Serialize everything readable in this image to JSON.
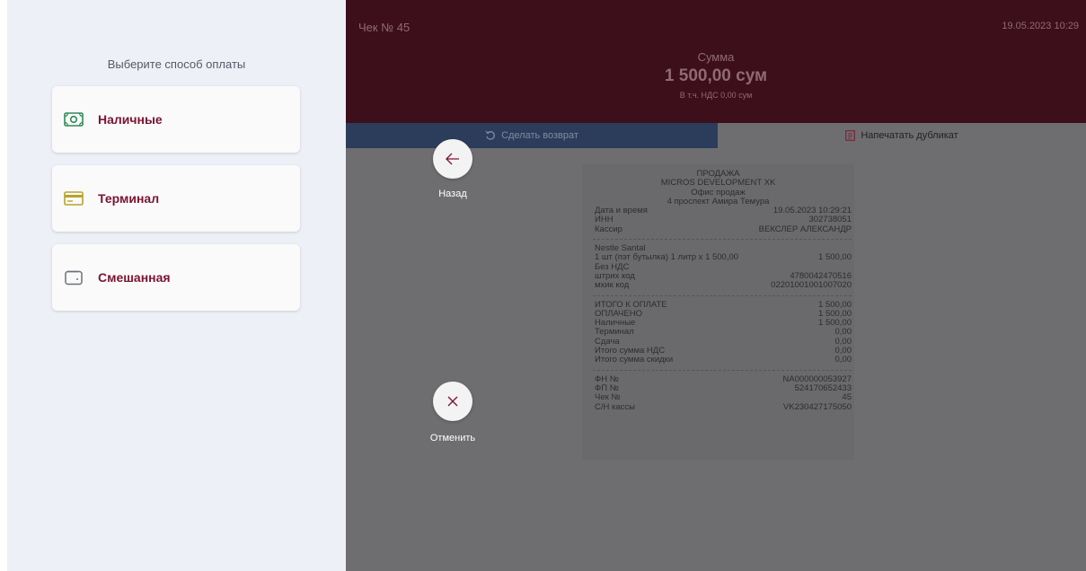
{
  "left_panel": {
    "title": "Выберите способ оплаты",
    "options": [
      {
        "label": "Наличные",
        "icon": "cash-icon"
      },
      {
        "label": "Терминал",
        "icon": "card-terminal-icon"
      },
      {
        "label": "Смешанная",
        "icon": "wallet-icon"
      }
    ]
  },
  "header": {
    "check_no": "Чек № 45",
    "datetime": "19.05.2023 10:29",
    "sum_label": "Сумма",
    "sum_value": "1 500,00 сум",
    "vat": "В т.ч. НДС 0,00 сум"
  },
  "tabs": {
    "refund": "Сделать возврат",
    "duplicate": "Напечатать дубликат"
  },
  "buttons": {
    "back": "Назад",
    "cancel": "Отменить"
  },
  "receipt": {
    "type": "ПРОДАЖА",
    "company": "MICROS DEVELOPMENT XK",
    "office": "Офис продаж",
    "address": "4 проспект Амира Темура",
    "info": [
      {
        "label": "Дата и время",
        "value": "19.05.2023 10:29:21"
      },
      {
        "label": "ИНН",
        "value": "302738051"
      },
      {
        "label": "Кассир",
        "value": "ВЕКСЛЕР АЛЕКСАНДР"
      }
    ],
    "item_name": "Nestle Santal",
    "item_line": "1 шт (пэт бутылка) 1 литр x 1 500,00",
    "item_total": "1 500,00",
    "item_vat": "Без НДС",
    "item_codes": [
      {
        "label": "штрих код",
        "value": "4780042470516"
      },
      {
        "label": "мхик код",
        "value": "02201001001007020"
      }
    ],
    "totals": [
      {
        "label": "ИТОГО К ОПЛАТЕ",
        "value": "1 500,00"
      },
      {
        "label": "ОПЛАЧЕНО",
        "value": "1 500,00"
      },
      {
        "label": "Наличные",
        "value": "1 500,00"
      },
      {
        "label": "Терминал",
        "value": "0,00"
      },
      {
        "label": "Сдача",
        "value": "0,00"
      },
      {
        "label": "Итого сумма НДС",
        "value": "0,00"
      },
      {
        "label": "Итого сумма скидки",
        "value": "0,00"
      }
    ],
    "fiscal": [
      {
        "label": "ФН №",
        "value": "NA000000053927"
      },
      {
        "label": "ФП №",
        "value": "524170652433"
      },
      {
        "label": "Чек №",
        "value": "45"
      },
      {
        "label": "С/Н кассы",
        "value": "VK230427175050"
      }
    ]
  },
  "colors": {
    "accent": "#7a1530",
    "header_bg": "#3c0f1b",
    "refund_tab_bg": "#2b3d5b",
    "cash_icon": "#2f8a57",
    "terminal_icon": "#b8a32a"
  }
}
